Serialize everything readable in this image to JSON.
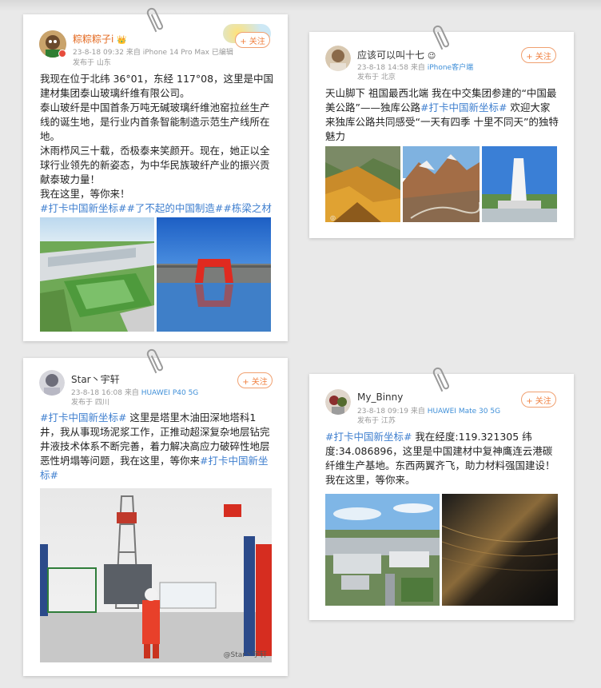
{
  "posts": [
    {
      "user": "粽粽粽子i",
      "user_badge": "👑",
      "time": "23-8-18 09:32",
      "via": "来自",
      "source": "iPhone 14 Pro Max",
      "edited": "已编辑",
      "location": "发布于 山东",
      "follow": "+ 关注",
      "paragraphs": [
        "我现在位于北纬 36°01，东经 117°08，这里是中国建材集团泰山玻璃纤维有限公司。",
        "泰山玻纤是中国首条万吨无碱玻璃纤维池窑拉丝生产线的诞生地，是行业内首条智能制造示范生产线所在地。",
        "沐雨栉风三十载，岙极泰来笑颜开。现在，她正以全球行业领先的新姿态，为中华民族玻纤产业的振兴贡献泰玻力量！",
        "我在这里，等你来！"
      ],
      "tags": "#打卡中国新坐标##了不起的中国制造##栋梁之材#"
    },
    {
      "user": "应该可以叫十七",
      "user_badge": "😉",
      "time": "23-8-18 14:58",
      "via": "来自",
      "source": "iPhone客户端",
      "location": "发布于 北京",
      "follow": "+ 关注",
      "text_before": "天山脚下 祖国最西北端 我在中交集团参建的“中国最美公路”——独库公路",
      "tag": "#打卡中国新坐标#",
      "text_after": "  欢迎大家来独库公路共同感受“一天有四季 十里不同天”的独特魅力"
    },
    {
      "user": "Star丶宇轩",
      "time": "23-8-18 16:08",
      "via": "来自",
      "source": "HUAWEI P40 5G",
      "location": "发布于 四川",
      "follow": "+ 关注",
      "tag": "#打卡中国新坐标#",
      "text_mid": " 这里是塔里木油田深地塔科1井，我从事现场泥浆工作，正推动超深复杂地层钻完井液技术体系不断完善，着力解决高应力破碎性地层恶性坍塌等问题，我在这里，等你来",
      "tag2": "#打卡中国新坐标#",
      "watermark": "@Star丶宇轩"
    },
    {
      "user": "My_Binny",
      "time": "23-8-18 09:19",
      "via": "来自",
      "source": "HUAWEI Mate 30 5G",
      "location": "发布于 江苏",
      "follow": "+ 关注",
      "tag": "#打卡中国新坐标#",
      "text_after": " 我在经度:119.321305 纬度:34.086896，这里是中国建材中复神鹰连云港碳纤维生产基地。东西两翼齐飞，助力材料强国建设！我在这里，等你来。"
    }
  ],
  "colors": {
    "tag": "#3f7fcf",
    "source": "#3f8fd8",
    "follow": "#f08040",
    "vip_name": "#e36a21"
  },
  "icons": [
    "paperclip-icon",
    "verified-badge-icon"
  ]
}
